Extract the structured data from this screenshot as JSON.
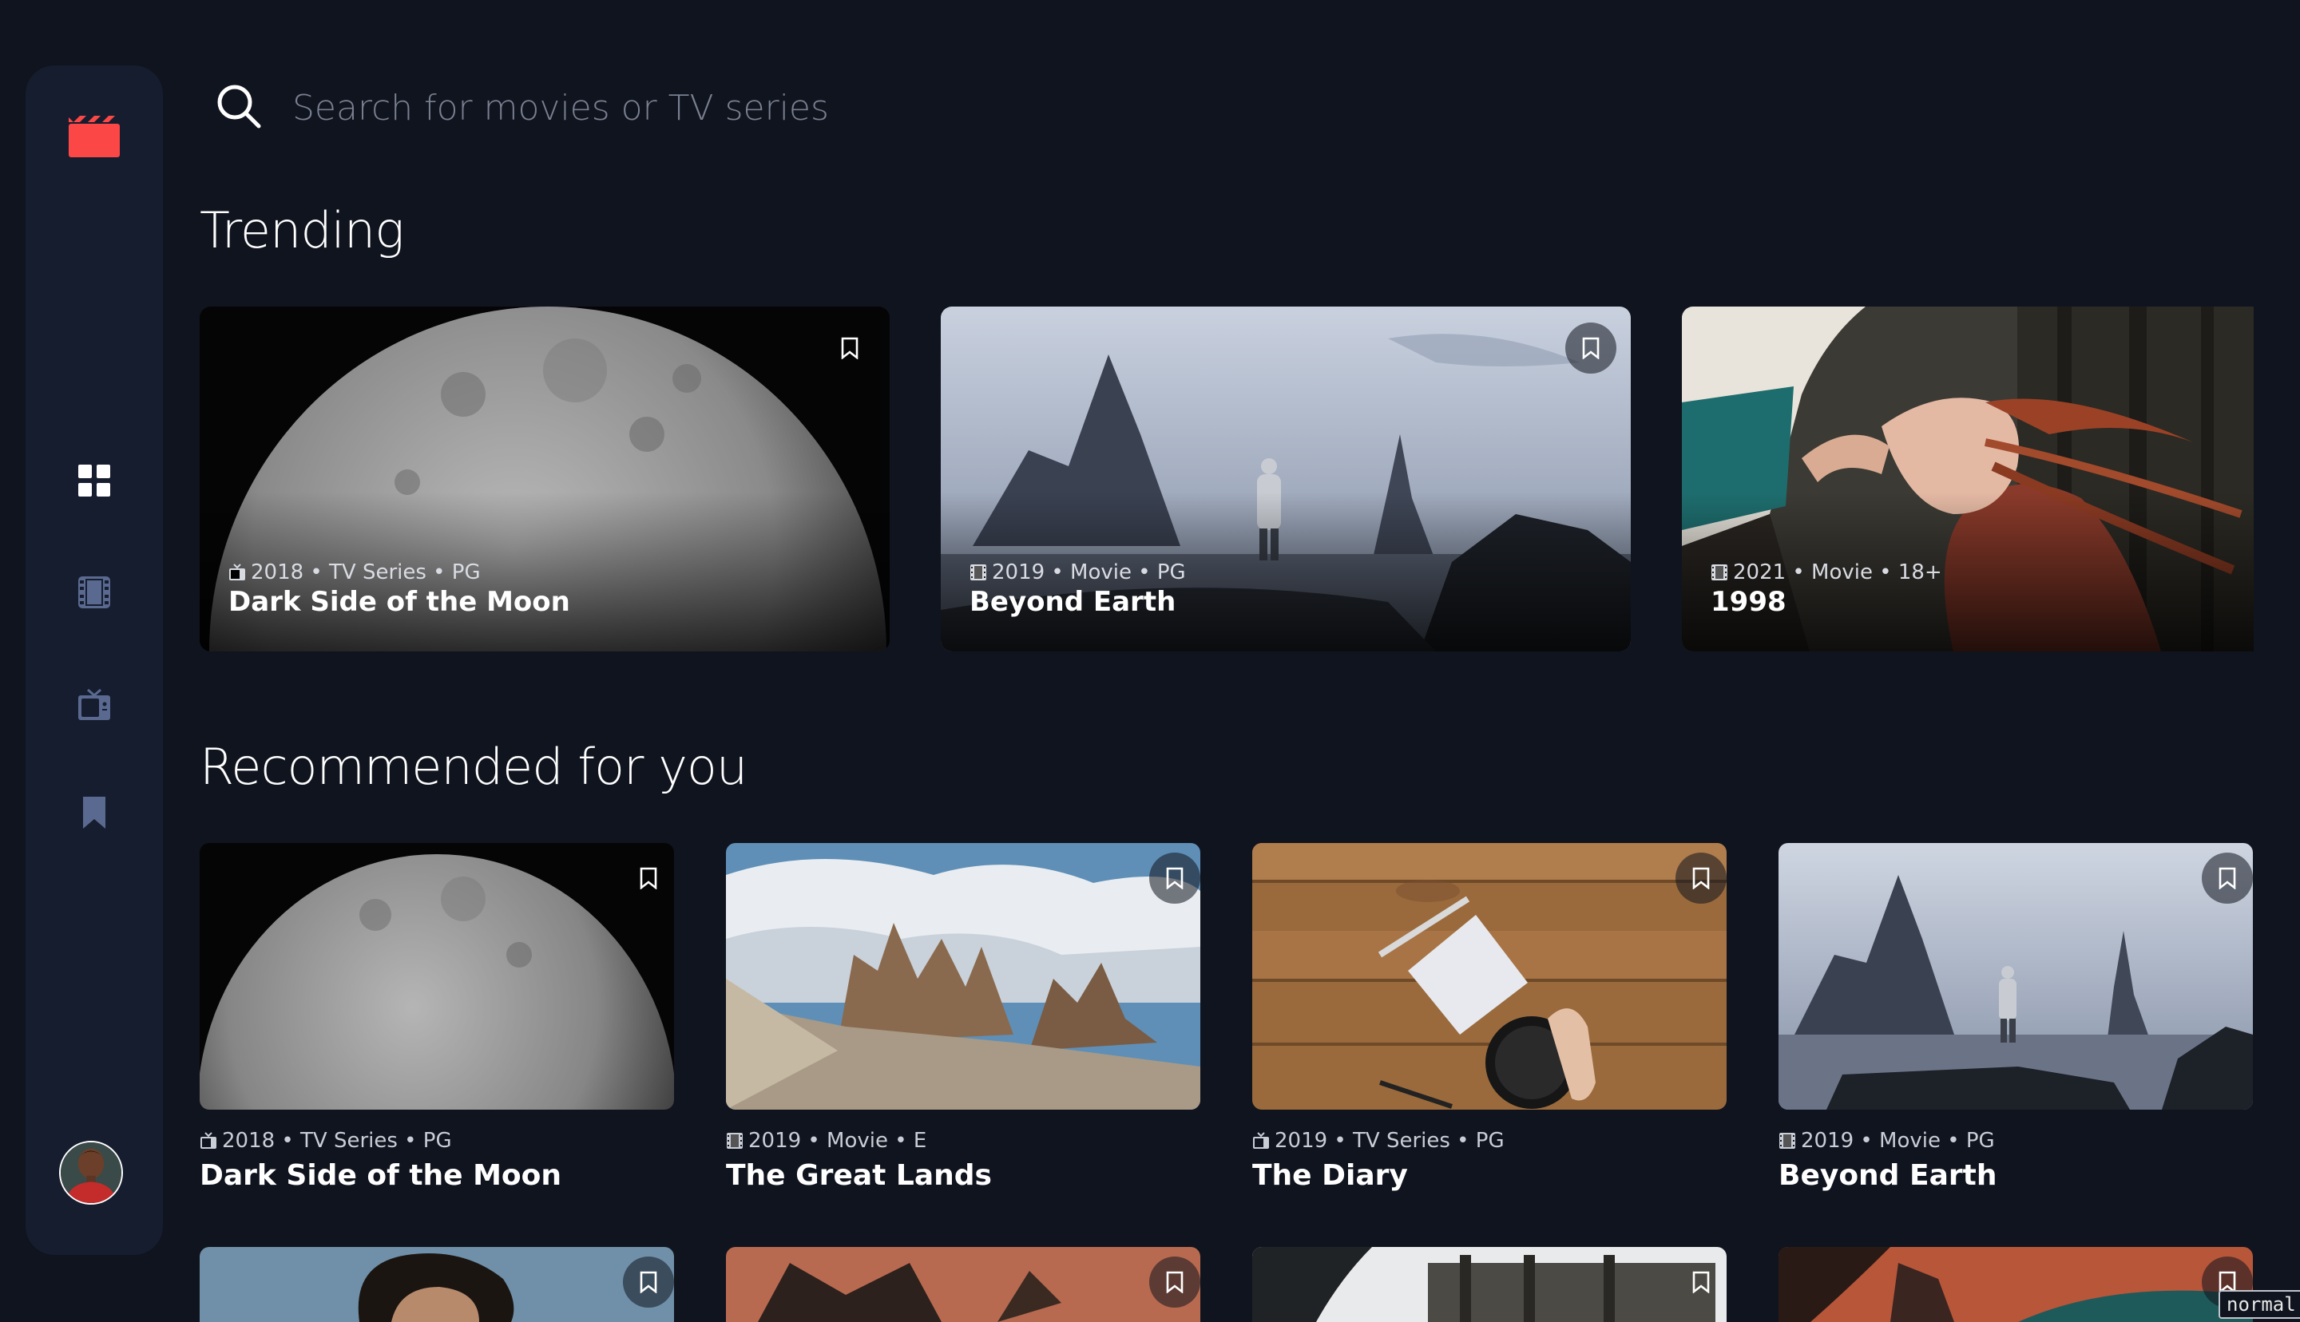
{
  "search": {
    "placeholder": "Search for movies or TV series"
  },
  "nav": {
    "items": [
      {
        "name": "home",
        "icon": "grid-icon",
        "active": true
      },
      {
        "name": "movies",
        "icon": "film-icon",
        "active": false
      },
      {
        "name": "tv-series",
        "icon": "tv-icon",
        "active": false
      },
      {
        "name": "bookmarks",
        "icon": "bookmark-icon",
        "active": false
      }
    ]
  },
  "trending": {
    "title": "Trending",
    "items": [
      {
        "meta": "2018 • TV Series • PG",
        "title": "Dark Side of the Moon",
        "category": "tv-icon"
      },
      {
        "meta": "2019 • Movie • PG",
        "title": "Beyond Earth",
        "category": "film-icon"
      },
      {
        "meta": "2021 • Movie • 18+",
        "title": "1998",
        "category": "film-icon"
      }
    ]
  },
  "recommended": {
    "title": "Recommended for you",
    "items": [
      {
        "meta": "2018 • TV Series • PG",
        "title": "Dark Side of the Moon",
        "category": "tv-icon"
      },
      {
        "meta": "2019 • Movie • E",
        "title": "The Great Lands",
        "category": "film-icon"
      },
      {
        "meta": "2019 • TV Series • PG",
        "title": "The Diary",
        "category": "tv-icon"
      },
      {
        "meta": "2019 • Movie • PG",
        "title": "Beyond Earth",
        "category": "film-icon"
      }
    ]
  },
  "status_tag": "normal",
  "colors": {
    "background": "#10141e",
    "sidebar": "#161d2f",
    "accent": "#fc4747",
    "nav_inactive": "#5a698f",
    "nav_active": "#ffffff"
  }
}
